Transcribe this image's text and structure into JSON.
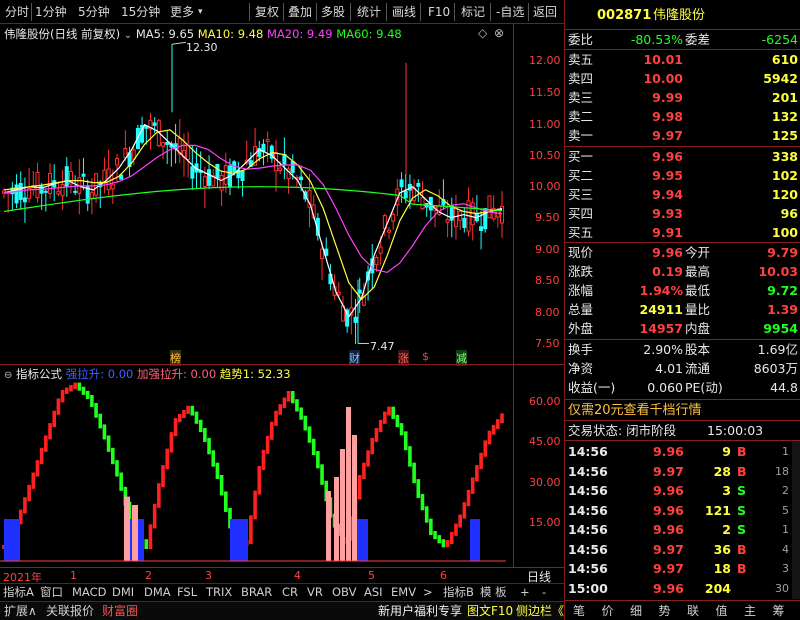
{
  "toolbar": {
    "left": [
      "分时",
      "1分钟",
      "5分钟",
      "15分钟",
      "更多"
    ],
    "right": [
      "复权",
      "叠加",
      "多股",
      "统计",
      "画线",
      "F10",
      "标记",
      "-自选",
      "返回"
    ]
  },
  "main_legend": {
    "title": "伟隆股份(日线 前复权)",
    "ma5": "MA5: 9.65",
    "ma10": "MA10: 9.48",
    "ma20": "MA20: 9.49",
    "ma60": "MA60: 9.48",
    "max_label": "12.30",
    "min_label": "7.47"
  },
  "markers": [
    "榜",
    "财",
    "涨",
    "$",
    "减"
  ],
  "sub_legend": {
    "name": "指标公式",
    "s1": "强拉升: 0.00",
    "s2": "加强拉升: 0.00",
    "s3": "趋势1: 52.33"
  },
  "price_axis": [
    "12.00",
    "11.50",
    "11.00",
    "10.50",
    "10.00",
    "9.50",
    "9.00",
    "8.50",
    "8.00",
    "7.50"
  ],
  "ind_axis": [
    "60.00",
    "45.00",
    "30.00",
    "15.00"
  ],
  "date_axis": [
    "2021年",
    "1",
    "2",
    "3",
    "4",
    "5",
    "6"
  ],
  "date_right": "日线",
  "indicator_tabs": [
    "指标A",
    "窗口",
    "MACD",
    "DMI",
    "DMA",
    "FSL",
    "TRIX",
    "BRAR",
    "CR",
    "VR",
    "OBV",
    "ASI",
    "EMV",
    ">",
    "指标B",
    "模 板",
    "+",
    "-"
  ],
  "status_left": [
    "扩展∧",
    "关联报价",
    "财富圈"
  ],
  "status_mid": [
    "新用户福利专享",
    "图文F10",
    "侧边栏《"
  ],
  "status_right": [
    "笔",
    "价",
    "细",
    "势",
    "联",
    "值",
    "主",
    "筹"
  ],
  "stock": {
    "code": "002871",
    "name": "伟隆股份"
  },
  "weibi": {
    "l1": "委比",
    "v1": "-80.53%",
    "l2": "委差",
    "v2": "-6254"
  },
  "asks": [
    {
      "label": "卖五",
      "price": "10.01",
      "vol": "610"
    },
    {
      "label": "卖四",
      "price": "10.00",
      "vol": "5942"
    },
    {
      "label": "卖三",
      "price": "9.99",
      "vol": "201"
    },
    {
      "label": "卖二",
      "price": "9.98",
      "vol": "132"
    },
    {
      "label": "卖一",
      "price": "9.97",
      "vol": "125"
    }
  ],
  "bids": [
    {
      "label": "买一",
      "price": "9.96",
      "vol": "338"
    },
    {
      "label": "买二",
      "price": "9.95",
      "vol": "102"
    },
    {
      "label": "买三",
      "price": "9.94",
      "vol": "120"
    },
    {
      "label": "买四",
      "price": "9.93",
      "vol": "96"
    },
    {
      "label": "买五",
      "price": "9.91",
      "vol": "100"
    }
  ],
  "stats": [
    {
      "l1": "现价",
      "v1": "9.96",
      "c1": "red",
      "l2": "今开",
      "v2": "9.79",
      "c2": "red"
    },
    {
      "l1": "涨跌",
      "v1": "0.19",
      "c1": "red",
      "l2": "最高",
      "v2": "10.03",
      "c2": "red"
    },
    {
      "l1": "涨幅",
      "v1": "1.94%",
      "c1": "red",
      "l2": "最低",
      "v2": "9.72",
      "c2": "green"
    },
    {
      "l1": "总量",
      "v1": "24911",
      "c1": "yellow",
      "l2": "量比",
      "v2": "1.39",
      "c2": "red"
    },
    {
      "l1": "外盘",
      "v1": "14957",
      "c1": "red",
      "l2": "内盘",
      "v2": "9954",
      "c2": "green"
    }
  ],
  "stats2": [
    {
      "l1": "换手",
      "v1": "2.90%",
      "l2": "股本",
      "v2": "1.69亿"
    },
    {
      "l1": "净资",
      "v1": "4.01",
      "l2": "流通",
      "v2": "8603万"
    },
    {
      "l1": "收益(一)",
      "v1": "0.060",
      "l2": "PE(动)",
      "v2": "44.8"
    }
  ],
  "promo": "仅需20元查看千档行情",
  "trade_status": {
    "label": "交易状态: 闭市阶段",
    "time": "15:00:03"
  },
  "ticks": [
    {
      "t": "14:56",
      "p": "9.96",
      "v": "9",
      "d": "B",
      "n": "1"
    },
    {
      "t": "14:56",
      "p": "9.97",
      "v": "28",
      "d": "B",
      "n": "18"
    },
    {
      "t": "14:56",
      "p": "9.96",
      "v": "3",
      "d": "S",
      "n": "2"
    },
    {
      "t": "14:56",
      "p": "9.96",
      "v": "121",
      "d": "S",
      "n": "5"
    },
    {
      "t": "14:56",
      "p": "9.96",
      "v": "2",
      "d": "S",
      "n": "1"
    },
    {
      "t": "14:56",
      "p": "9.97",
      "v": "36",
      "d": "B",
      "n": "4"
    },
    {
      "t": "14:56",
      "p": "9.97",
      "v": "18",
      "d": "B",
      "n": "3"
    },
    {
      "t": "15:00",
      "p": "9.96",
      "v": "204",
      "d": "",
      "n": "30"
    }
  ],
  "colors": {
    "up": "#ff3030",
    "down": "#20ffff",
    "ma5": "#ffffff",
    "ma10": "#ffff40",
    "ma20": "#ff40ff",
    "ma60": "#20ff20",
    "border": "#8a1f1f"
  },
  "chart_data": [
    {
      "type": "candlestick",
      "ylim": [
        7.3,
        12.4
      ],
      "series": [
        {
          "name": "MA5",
          "values": [
            9.9,
            9.95,
            10.0,
            9.98,
            10.05,
            10.1,
            10.0,
            9.95,
            10.1,
            10.3,
            10.6,
            11.0,
            10.9,
            10.7,
            10.5,
            10.3,
            10.2,
            10.1,
            10.2,
            10.4,
            10.6,
            10.5,
            10.3,
            10.1,
            9.7,
            9.0,
            8.3,
            7.9,
            8.2,
            8.9,
            9.4,
            9.9,
            10.0,
            9.8,
            9.6,
            9.5,
            9.55,
            9.5,
            9.6,
            9.65
          ]
        }
      ]
    },
    {
      "type": "bar",
      "ylim": [
        0,
        65
      ],
      "series": [
        {
          "name": "趋势1",
          "values": [
            5,
            15,
            30,
            45,
            60,
            63,
            58,
            45,
            30,
            12,
            5,
            30,
            50,
            55,
            45,
            30,
            10,
            5,
            35,
            52,
            60,
            50,
            35,
            15,
            5,
            30,
            45,
            55,
            45,
            25,
            10,
            5,
            15,
            30,
            45,
            52
          ]
        }
      ]
    }
  ]
}
